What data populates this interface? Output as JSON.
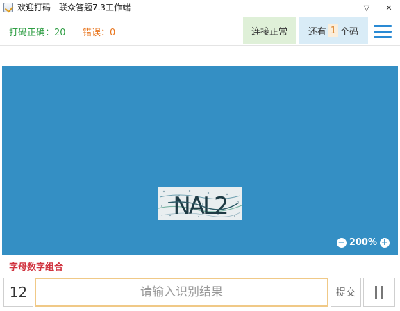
{
  "window": {
    "title": "欢迎打码 - 联众答题7.3工作端",
    "min_glyph": "▽",
    "close_glyph": "✕"
  },
  "status": {
    "correct_label": "打码正确：20",
    "error_label": "错误：0",
    "connection": "连接正常",
    "remaining_prefix": "还有",
    "remaining_count": "1",
    "remaining_suffix": "个码"
  },
  "captcha": {
    "text": "NAL2",
    "zoom_level": "200%",
    "zoom_out_glyph": "−",
    "zoom_in_glyph": "+"
  },
  "hint": "字母数字组合",
  "input": {
    "countdown": "12",
    "placeholder": "请输入识别结果",
    "submit_label": "提交"
  },
  "colors": {
    "captcha_bg": "#348fc4",
    "correct": "#2f9e44",
    "error": "#e8731a",
    "hint": "#d0333f"
  }
}
